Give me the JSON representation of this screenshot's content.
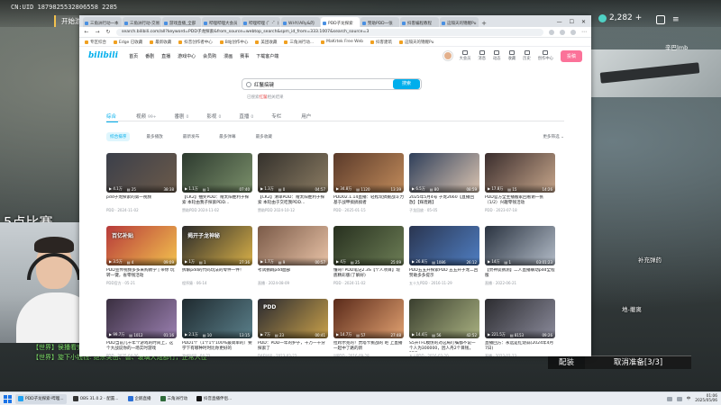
{
  "game": {
    "stream_id": "CN:UID 1879825532806558 2285",
    "start_button": "开始游戏",
    "coins": "2,282",
    "coin_plus": "+",
    "menu_glyph": "≡",
    "match_text": "5点比赛",
    "player_tag": "辛巴lmb",
    "map_label_1": "补充弹药",
    "map_label_2": "地-撤离",
    "match_button": "配装",
    "cancel_ready_button": "取消准备[3/3]",
    "chat": [
      "【世界】侯播看完辛巴",
      "【世界】旋下小钱钱: 绝杀突击、兽、玻璃大炮都行，正常入位"
    ]
  },
  "browser": {
    "tabs": [
      {
        "label": "三角洲行动一本"
      },
      {
        "label": "三角洲行动-交易"
      },
      {
        "label": "游戏直播_全部"
      },
      {
        "label": "哔哩哔哩大会员"
      },
      {
        "label": "哔哩哔哩 (゜-゜)"
      },
      {
        "label": "WHY/ARy&的"
      },
      {
        "label": "PDD子龙探索"
      },
      {
        "label": "赞助PDD一张"
      },
      {
        "label": "抖客编程教程"
      },
      {
        "label": "这隔天的锦鲤Pu"
      }
    ],
    "tab_add": "+",
    "win_min": "—",
    "win_max": "☐",
    "win_close": "✕",
    "address": "search.bilibili.com/all?keyword=PDD子龙探索&from_source=webtop_search&spm_id_from=333.1007&search_source=3",
    "bookmarks": [
      "专区综合",
      "Edge 已收藏",
      "最新收藏",
      "抖音创作者中心",
      "B站创作中心",
      "美团收藏",
      "三角洲行动...",
      "MaKrtek Free Web",
      "抖客建筑",
      "这隔天的锦鲤Pu"
    ]
  },
  "bili": {
    "logo": "bilibili",
    "nav": [
      "首页",
      "番剧",
      "直播",
      "游戏中心",
      "会员购",
      "漫画",
      "赛事",
      "下载客户端"
    ],
    "header_items": [
      "大会员",
      "消息",
      "动态",
      "收藏",
      "历史",
      "创作中心"
    ],
    "upload": "投稿",
    "search_value": "红鬣搞键",
    "search_button": "搜索",
    "correction_prefix": "已搜索",
    "correction_keyword": "红鬣",
    "correction_suffix": "相关结果",
    "tabs": [
      {
        "label": "综合",
        "count": ""
      },
      {
        "label": "视频",
        "count": "99+"
      },
      {
        "label": "番剧",
        "count": "0"
      },
      {
        "label": "影视",
        "count": "0"
      },
      {
        "label": "直播",
        "count": "0"
      },
      {
        "label": "专栏",
        "count": ""
      },
      {
        "label": "用户",
        "count": ""
      }
    ],
    "filters": [
      "综合排序",
      "最多播放",
      "最新发布",
      "最多弹幕",
      "最多收藏"
    ],
    "more_filter": "更多筛选 ⌄"
  },
  "videos": [
    {
      "title": "pdd子龙探索的第一视频",
      "author": "PDD · 2024-11-02",
      "views": "4.1万",
      "danmaku": "25",
      "duration": "38:38",
      "overlay": ""
    },
    {
      "title": "【CK2】抽奖PDD：赠太阳胜利子探索 本轮由我子探索PDD...",
      "author": "赞助PDD 2024-11-02",
      "views": "1.1万",
      "danmaku": "1",
      "duration": "07:40",
      "overlay": ""
    },
    {
      "title": "【CK2】清单PDD：赠太阳胜利子探索 本轮由于交吃我PDD...",
      "author": "赞助PDD 2024-10-12",
      "views": "1.3万",
      "danmaku": "0",
      "duration": "04:57",
      "overlay": ""
    },
    {
      "title": "PDD02.1.14直播：轻松玩搞掘战斗力 基于战甲搞搞搞者",
      "author": "PDD · 2025-01-15",
      "views": "34.8万",
      "danmaku": "1120",
      "duration": "13:39",
      "overlay": ""
    },
    {
      "title": "2025年5月4号 子龙2660【直播回放】【辉煌路】",
      "author": "子龙回放 · 05-05",
      "views": "6.5万",
      "danmaku": "80",
      "duration": "08:59",
      "overlay": ""
    },
    {
      "title": "PDD官方全主播搬家回看谢一张（1/2）兴趣零钱活动",
      "author": "PDD · 2023-07-18",
      "views": "17.8万",
      "danmaku": "15",
      "duration": "14:26",
      "overlay": ""
    },
    {
      "title": "PDD宣传视频多多采购教学 | 带你 玩转一键，省零钱活动",
      "author": "PDD官方 · 05-21",
      "views": "3.5万",
      "danmaku": "4",
      "duration": "09:09",
      "overlay": "百亿补贴"
    },
    {
      "title": "拆解pdd的代码玩法的零件一件！",
      "author": "程序猿 · 06-14",
      "views": "1万",
      "danmaku": "1",
      "duration": "27:36",
      "overlay": "揭开子龙神秘"
    },
    {
      "title": "考试鹦鹉pdd面部",
      "author": "直播 · 2024-08-09",
      "views": "1.7万",
      "danmaku": "9",
      "duration": "00:57",
      "overlay": ""
    },
    {
      "title": "懂哥! PDD笔记2.3S【个人项目】现底精彩版(了解好)",
      "author": "PDD · 2024-11-02",
      "views": "4万",
      "danmaku": "25",
      "duration": "25:09",
      "overlay": ""
    },
    {
      "title": "PDD五五开探索PDD 五五开子龙二回 赞助多多提示",
      "author": "五十九PDD · 2016-11-29",
      "views": "26.8万",
      "danmaku": "1086",
      "duration": "26:12",
      "overlay": ""
    },
    {
      "title": "【赞神谈猜测】二人直播联动pdd全程版",
      "author": "直播 · 2022-06-21",
      "views": "14万",
      "danmaku": "1",
      "duration": "03:01:23",
      "overlay": ""
    },
    {
      "title": "PDD当前几十年个游戏的时间上，这个大战说你的一场实时游戏",
      "author": "PDD · 2025-04-06",
      "views": "99.7万",
      "danmaku": "1012",
      "duration": "01:16",
      "overlay": ""
    },
    {
      "title": "PDD1个（1个1个100%最简单的）要学下有哪种时时比你更好的",
      "author": "游戏时间 · 04-21",
      "views": "2.1万",
      "danmaku": "10",
      "duration": "13:15",
      "overlay": ""
    },
    {
      "title": "PDD：PDD一年的护子，十万一十分探索了 ",
      "author": "DAE时间 · 2023-03-22",
      "views": "7万",
      "danmaku": "23",
      "duration": "00:41",
      "overlay": "PDD"
    },
    {
      "title": "拉跨尔克的！贾塔卡挑战的 吧 上直播一起中了路的新",
      "author": "叫PDD · 2016-09-28",
      "views": "14.7万",
      "danmaku": "57",
      "duration": "27:48",
      "overlay": ""
    },
    {
      "title": "S5开TFL模仿的对这局叮嘱都不说一个人为300000，因人丹2个目钱，PDD",
      "author": "五十PDD · 2016-03-20",
      "views": "14.4万",
      "danmaku": "56",
      "duration": "42:52",
      "overlay": ""
    },
    {
      "title": "直播回方：永远是红烧蒜(2024年4月7日)",
      "author": "直播 · 2023-02-23",
      "views": "221.5万",
      "danmaku": "8153",
      "duration": "09:26",
      "overlay": ""
    }
  ],
  "taskbar": {
    "items": [
      {
        "label": "PDD子龙探索-哔哩..."
      },
      {
        "label": "OBS 31.0.2 - 配置..."
      },
      {
        "label": "企鹅直播"
      },
      {
        "label": "三角洲行动"
      },
      {
        "label": "抖音直播伴侣..."
      }
    ],
    "time": "01:06",
    "date": "2025/05/06",
    "lang": "中"
  },
  "colors": {
    "bili_blue": "#00aeec",
    "bili_pink": "#fb7299",
    "chat_green": "#7fe06a"
  }
}
